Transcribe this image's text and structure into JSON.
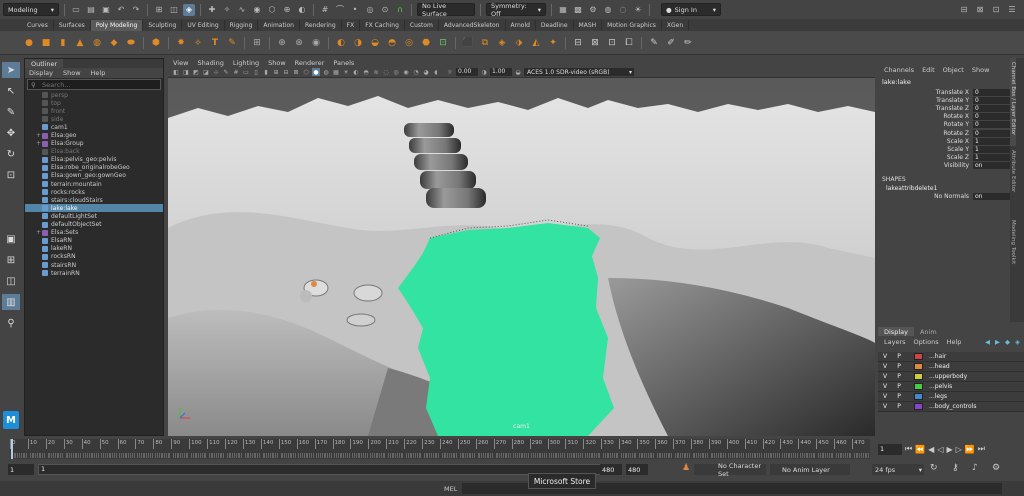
{
  "statusline": {
    "menuset": "Modeling",
    "live_surface": "No Live Surface",
    "symmetry": "Symmetry: Off",
    "signin": "Sign In"
  },
  "shelf_tabs": [
    "Curves",
    "Surfaces",
    "Poly Modeling",
    "Sculpting",
    "UV Editing",
    "Rigging",
    "Animation",
    "Rendering",
    "FX",
    "FX Caching",
    "Custom",
    "AdvancedSkeleton",
    "Arnold",
    "Deadline",
    "MASH",
    "Motion Graphics",
    "XGen"
  ],
  "outliner": {
    "tab": "Outliner",
    "menu": [
      "Display",
      "Show",
      "Help"
    ],
    "search_placeholder": "Search...",
    "items": [
      {
        "label": "persp",
        "grey": true,
        "exp": ""
      },
      {
        "label": "top",
        "grey": true,
        "exp": ""
      },
      {
        "label": "front",
        "grey": true,
        "exp": ""
      },
      {
        "label": "side",
        "grey": true,
        "exp": ""
      },
      {
        "label": "cam1",
        "grey": false,
        "exp": ""
      },
      {
        "label": "Elsa:geo",
        "grey": false,
        "exp": "+"
      },
      {
        "label": "Elsa:Group",
        "grey": false,
        "exp": "+"
      },
      {
        "label": "Elsa:back",
        "grey": true,
        "exp": ""
      },
      {
        "label": "Elsa:pelvis_geo:pelvis",
        "grey": false,
        "exp": ""
      },
      {
        "label": "Elsa:robe_originalrobeGeo",
        "grey": false,
        "exp": ""
      },
      {
        "label": "Elsa:gown_geo:gownGeo",
        "grey": false,
        "exp": ""
      },
      {
        "label": "terrain:mountain",
        "grey": false,
        "exp": ""
      },
      {
        "label": "rocks:rocks",
        "grey": false,
        "exp": ""
      },
      {
        "label": "stairs:cloudStairs",
        "grey": false,
        "exp": ""
      },
      {
        "label": "lake:lake",
        "grey": false,
        "exp": "",
        "sel": true
      },
      {
        "label": "defaultLightSet",
        "grey": false,
        "exp": ""
      },
      {
        "label": "defaultObjectSet",
        "grey": false,
        "exp": ""
      },
      {
        "label": "Elsa:Sets",
        "grey": false,
        "exp": "+"
      },
      {
        "label": "ElsaRN",
        "grey": false,
        "exp": ""
      },
      {
        "label": "lakeRN",
        "grey": false,
        "exp": ""
      },
      {
        "label": "rocksRN",
        "grey": false,
        "exp": ""
      },
      {
        "label": "stairsRN",
        "grey": false,
        "exp": ""
      },
      {
        "label": "terrainRN",
        "grey": false,
        "exp": ""
      }
    ]
  },
  "viewport": {
    "menu": [
      "View",
      "Shading",
      "Lighting",
      "Show",
      "Renderer",
      "Panels"
    ],
    "field_a": "0.00",
    "field_b": "1.00",
    "colorspace": "ACES 1.0 SDR-video (sRGB)",
    "camera_label": "cam1"
  },
  "channelbox": {
    "menu": [
      "Channels",
      "Edit",
      "Object",
      "Show"
    ],
    "object": "lake:lake",
    "attrs": [
      {
        "label": "Translate X",
        "value": "0"
      },
      {
        "label": "Translate Y",
        "value": "0"
      },
      {
        "label": "Translate Z",
        "value": "0"
      },
      {
        "label": "Rotate X",
        "value": "0"
      },
      {
        "label": "Rotate Y",
        "value": "0"
      },
      {
        "label": "Rotate Z",
        "value": "0"
      },
      {
        "label": "Scale X",
        "value": "1"
      },
      {
        "label": "Scale Y",
        "value": "1"
      },
      {
        "label": "Scale Z",
        "value": "1"
      },
      {
        "label": "Visibility",
        "value": "on"
      }
    ],
    "shapes_header": "SHAPES",
    "shape_name": "lakeattribdelete1",
    "shape_attr": {
      "label": "No Normals",
      "value": "on"
    },
    "side_tabs": [
      "Channel Box / Layer Editor",
      "Attribute Editor",
      "Modeling Toolkit"
    ]
  },
  "layers": {
    "tabs": [
      "Display",
      "Anim"
    ],
    "menu": [
      "Layers",
      "Options",
      "Help"
    ],
    "rows": [
      {
        "v": "V",
        "p": "P",
        "name": "...hair"
      },
      {
        "v": "V",
        "p": "P",
        "name": "...head"
      },
      {
        "v": "V",
        "p": "P",
        "name": "...upperbody"
      },
      {
        "v": "V",
        "p": "P",
        "name": "...pelvis"
      },
      {
        "v": "V",
        "p": "P",
        "name": "...legs"
      },
      {
        "v": "V",
        "p": "P",
        "name": "...body_controls"
      }
    ]
  },
  "timeline": {
    "ticks": [
      "0",
      "10",
      "20",
      "30",
      "40",
      "50",
      "60",
      "70",
      "80",
      "90",
      "100",
      "110",
      "120",
      "130",
      "140",
      "150",
      "160",
      "170",
      "180",
      "190",
      "200",
      "210",
      "220",
      "230",
      "240",
      "250",
      "260",
      "270",
      "280",
      "290",
      "300",
      "310",
      "320",
      "330",
      "340",
      "350",
      "360",
      "370",
      "380",
      "390",
      "400",
      "410",
      "420",
      "430",
      "440",
      "450",
      "460",
      "470"
    ],
    "current_frame": "1"
  },
  "range": {
    "start": "1",
    "inner_start": "1",
    "inner_end": "480",
    "end_a": "480",
    "end_b": "480",
    "character_set": "No Character Set",
    "anim_layer": "No Anim Layer",
    "fps": "24 fps"
  },
  "cmdline": {
    "label": "MEL",
    "tooltip": "Microsoft Store"
  },
  "colors": {
    "lake": "#33e3a1",
    "selection": "#5285a6",
    "accent": "#5d7c98"
  }
}
